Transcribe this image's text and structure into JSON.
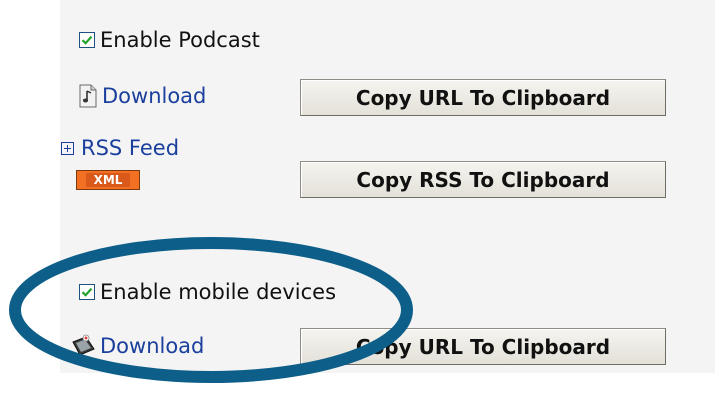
{
  "podcast": {
    "enable_label": "Enable Podcast",
    "enabled": true,
    "download_label": "Download",
    "copy_url_label": "Copy URL To Clipboard"
  },
  "rss": {
    "feed_label": "RSS Feed",
    "badge_text": "XML",
    "copy_rss_label": "Copy RSS To Clipboard"
  },
  "mobile": {
    "enable_label": "Enable mobile devices",
    "enabled": true,
    "download_label": "Download",
    "copy_url_label": "Copy URL To Clipboard"
  },
  "icons": {
    "podcast_download": "audio-file-icon",
    "mobile_download": "mobile-device-icon",
    "expand": "plus-expand-icon"
  },
  "colors": {
    "link": "#1a3f9c",
    "highlight_ellipse": "#0d5f8a",
    "xml_badge": "#f36f21"
  }
}
